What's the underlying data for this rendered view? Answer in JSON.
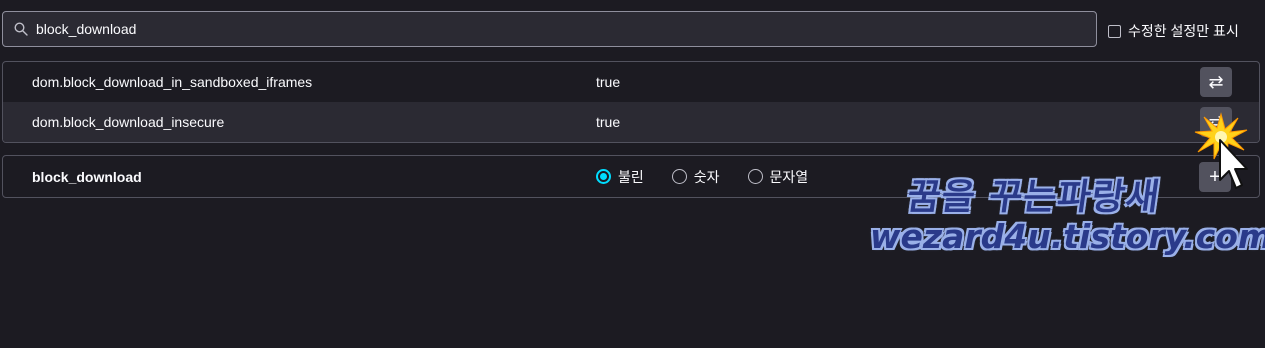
{
  "search": {
    "value": "block_download",
    "placeholder": ""
  },
  "show_modified_only": {
    "label": "수정한 설정만 표시",
    "checked": false
  },
  "prefs": [
    {
      "name": "dom.block_download_in_sandboxed_iframes",
      "value": "true",
      "action_icon": "toggle-icon"
    },
    {
      "name": "dom.block_download_insecure",
      "value": "true",
      "action_icon": "toggle-icon"
    }
  ],
  "new_pref": {
    "name": "block_download",
    "types": [
      {
        "label": "불린",
        "selected": true
      },
      {
        "label": "숫자",
        "selected": false
      },
      {
        "label": "문자열",
        "selected": false
      }
    ],
    "add_icon": "plus-icon"
  },
  "watermark": {
    "line1": "꿈을 꾸는파랑새",
    "line2": "wezard4u.tistory.com"
  },
  "colors": {
    "background": "#1c1b22",
    "row_alt": "#2b2a33",
    "accent": "#00ddff",
    "button": "#52525e"
  }
}
